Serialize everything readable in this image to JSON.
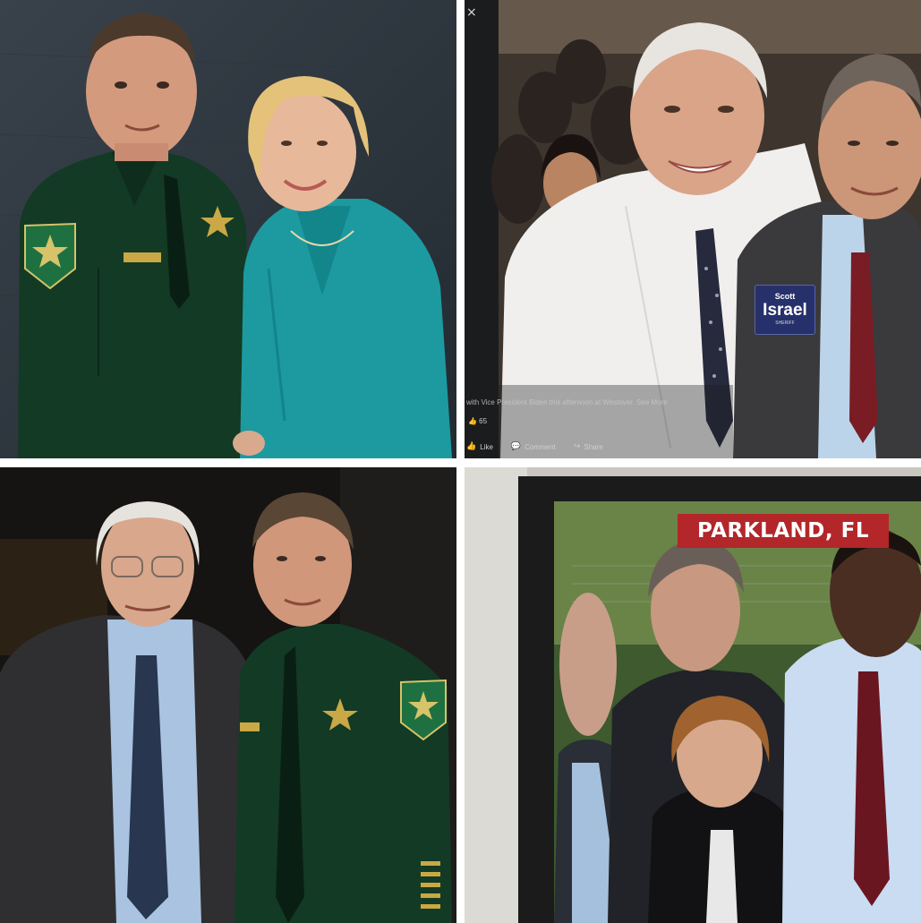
{
  "panels": {
    "top_right": {
      "close_glyph": "×",
      "caption": "with Vice President Biden this afternoon at Westover. See More",
      "likes": "👍 65",
      "actions": [
        {
          "icon": "thumbs-up-icon",
          "glyph": "👍",
          "label": "Like"
        },
        {
          "icon": "comment-icon",
          "glyph": "💬",
          "label": "Comment"
        },
        {
          "icon": "share-icon",
          "glyph": "↪",
          "label": "Share"
        }
      ],
      "campaign_button": {
        "small_text": "Scott",
        "big_text": "Israel",
        "tiny_text": "SHERIFF"
      }
    },
    "bottom_right": {
      "banner_text": "PARKLAND, FL"
    }
  },
  "colors": {
    "backdrop_dark": "#2a323a",
    "sheriff_green": "#123a24",
    "teal_jacket": "#1a9aa0",
    "banner_red": "#b3262a",
    "button_navy": "#26306a"
  }
}
